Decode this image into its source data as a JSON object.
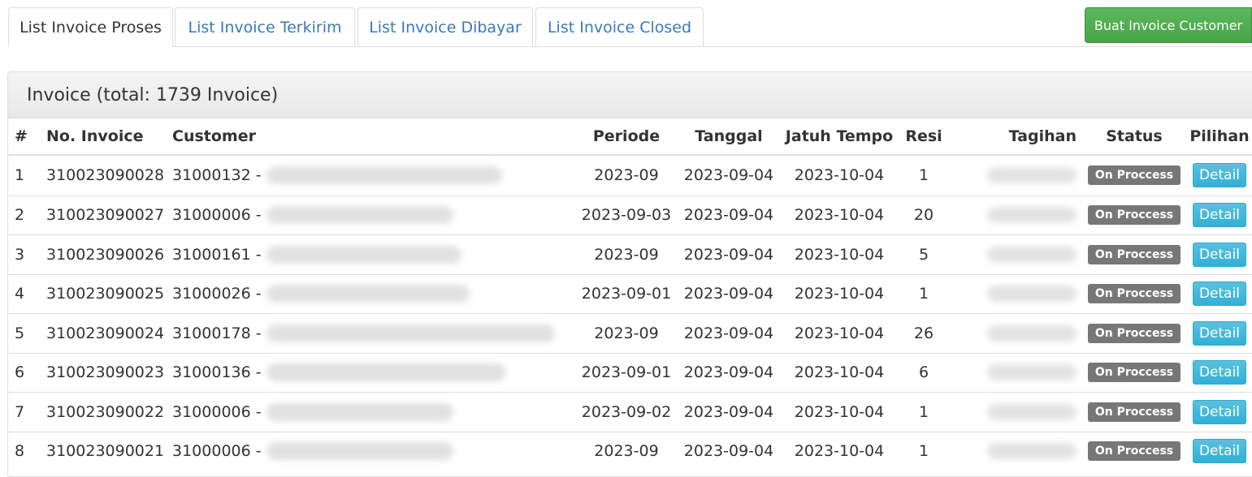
{
  "tabs": [
    {
      "label": "List Invoice Proses",
      "active": true
    },
    {
      "label": "List Invoice Terkirim",
      "active": false
    },
    {
      "label": "List Invoice Dibayar",
      "active": false
    },
    {
      "label": "List Invoice Closed",
      "active": false
    }
  ],
  "create_button": "Buat Invoice Customer",
  "panel": {
    "title": "Invoice (total: 1739 Invoice)"
  },
  "columns": {
    "no": "#",
    "invoice": "No. Invoice",
    "customer": "Customer",
    "periode": "Periode",
    "tanggal": "Tanggal",
    "jatuh_tempo": "Jatuh Tempo",
    "resi": "Resi",
    "tagihan": "Tagihan",
    "status": "Status",
    "pilihan": "Pilihan"
  },
  "rows": [
    {
      "no": "1",
      "invoice": "310023090028",
      "customer": "31000132 -",
      "periode": "2023-09",
      "tanggal": "2023-09-04",
      "jatuh_tempo": "2023-10-04",
      "resi": "1",
      "status": "On Proccess",
      "action": "Detail"
    },
    {
      "no": "2",
      "invoice": "310023090027",
      "customer": "31000006 -",
      "periode": "2023-09-03",
      "tanggal": "2023-09-04",
      "jatuh_tempo": "2023-10-04",
      "resi": "20",
      "status": "On Proccess",
      "action": "Detail"
    },
    {
      "no": "3",
      "invoice": "310023090026",
      "customer": "31000161 -",
      "periode": "2023-09",
      "tanggal": "2023-09-04",
      "jatuh_tempo": "2023-10-04",
      "resi": "5",
      "status": "On Proccess",
      "action": "Detail"
    },
    {
      "no": "4",
      "invoice": "310023090025",
      "customer": "31000026 -",
      "periode": "2023-09-01",
      "tanggal": "2023-09-04",
      "jatuh_tempo": "2023-10-04",
      "resi": "1",
      "status": "On Proccess",
      "action": "Detail"
    },
    {
      "no": "5",
      "invoice": "310023090024",
      "customer": "31000178 -",
      "periode": "2023-09",
      "tanggal": "2023-09-04",
      "jatuh_tempo": "2023-10-04",
      "resi": "26",
      "status": "On Proccess",
      "action": "Detail"
    },
    {
      "no": "6",
      "invoice": "310023090023",
      "customer": "31000136 -",
      "periode": "2023-09-01",
      "tanggal": "2023-09-04",
      "jatuh_tempo": "2023-10-04",
      "resi": "6",
      "status": "On Proccess",
      "action": "Detail"
    },
    {
      "no": "7",
      "invoice": "310023090022",
      "customer": "31000006 -",
      "periode": "2023-09-02",
      "tanggal": "2023-09-04",
      "jatuh_tempo": "2023-10-04",
      "resi": "1",
      "status": "On Proccess",
      "action": "Detail"
    },
    {
      "no": "8",
      "invoice": "310023090021",
      "customer": "31000006 -",
      "periode": "2023-09",
      "tanggal": "2023-09-04",
      "jatuh_tempo": "2023-10-04",
      "resi": "1",
      "status": "On Proccess",
      "action": "Detail"
    }
  ]
}
